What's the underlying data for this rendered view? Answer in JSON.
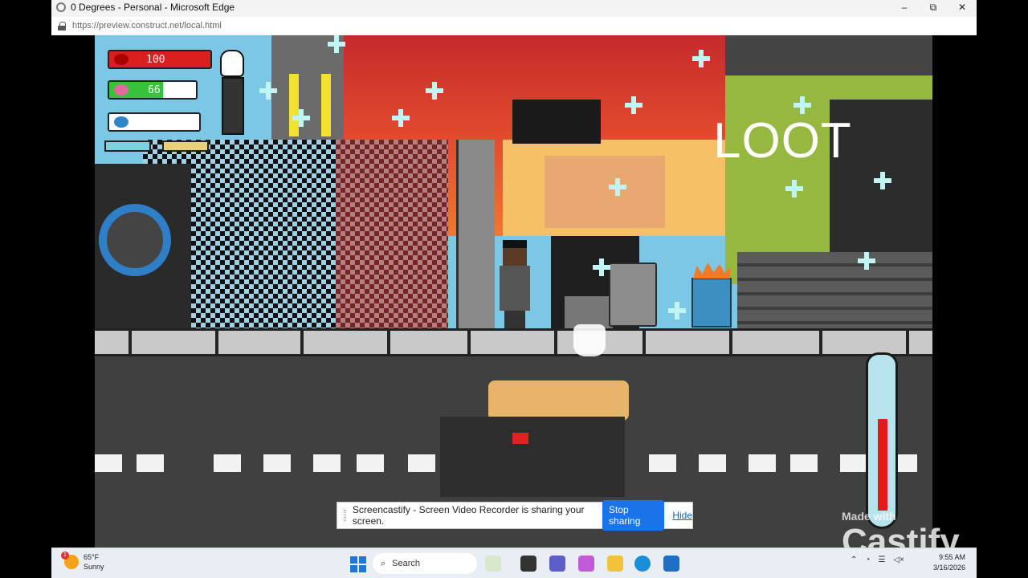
{
  "browser": {
    "title": "0 Degrees - Personal - Microsoft Edge",
    "url": "https://preview.construct.net/local.html",
    "controls": {
      "minimize": "–",
      "maximize": "⧉",
      "close": "✕"
    }
  },
  "hud": {
    "health": "100",
    "stamina": "66",
    "stamina_level": 0.62,
    "temperature_level": 0.6
  },
  "game": {
    "loot_label": "LOOT"
  },
  "share_banner": {
    "message": "Screencastify - Screen Video Recorder is sharing your screen.",
    "stop_label": "Stop sharing",
    "hide_label": "Hide"
  },
  "watermark": {
    "made_with": "Made with",
    "brand": "Castify"
  },
  "taskbar": {
    "weather_temp": "65°F",
    "weather_cond": "Sunny",
    "weather_badge": "1",
    "search_placeholder": "Search",
    "time": "9:55 AM",
    "date": "3/16/2026"
  },
  "colors": {
    "health": "#d91f1f",
    "stamina": "#36c23a",
    "accent": "#1a73e8"
  }
}
